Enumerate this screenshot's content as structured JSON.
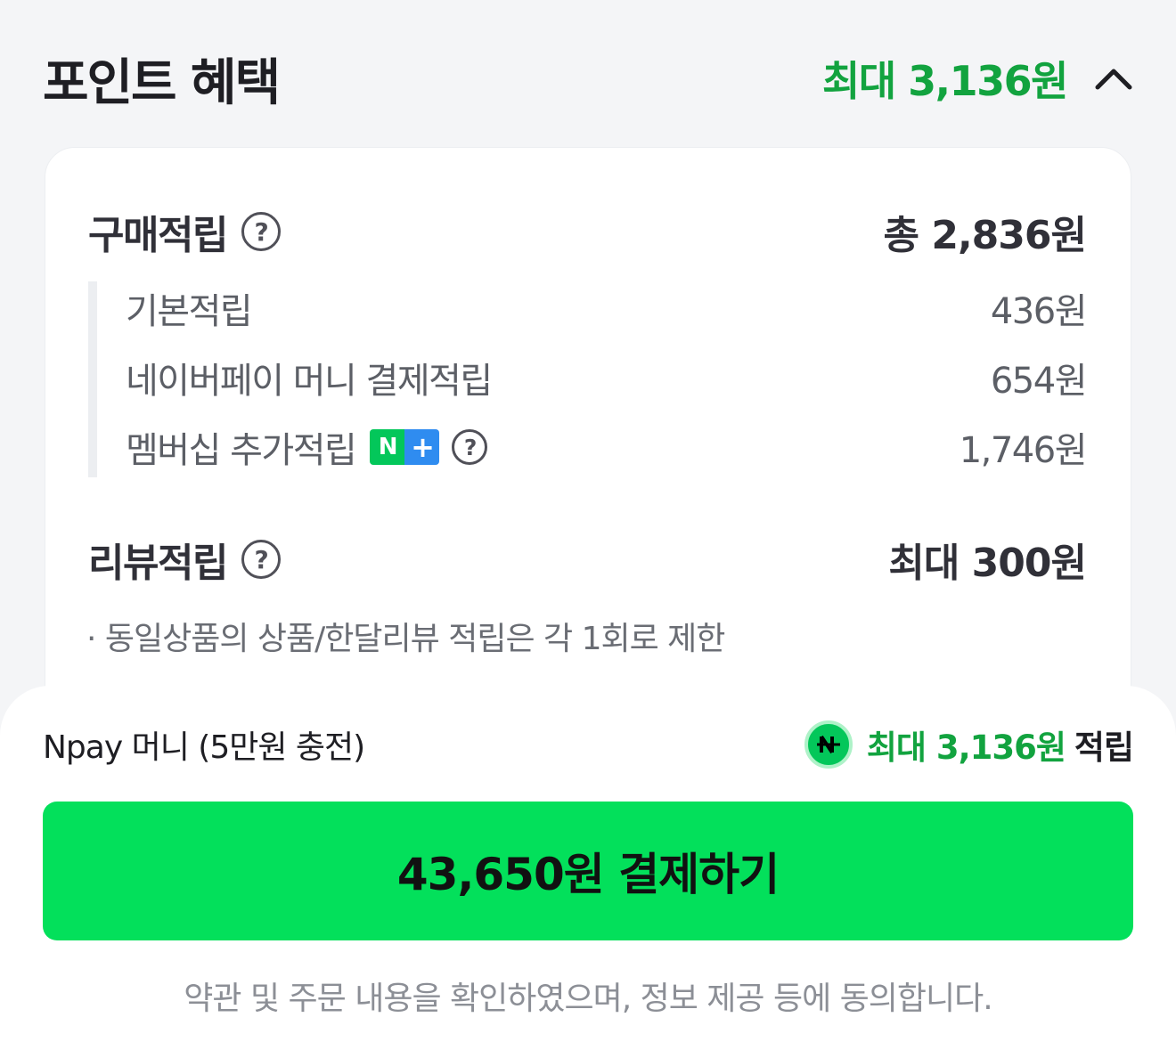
{
  "header": {
    "title": "포인트 혜택",
    "max_benefit": "최대 3,136원"
  },
  "purchase": {
    "label": "구매적립",
    "total": "총 2,836원",
    "items": [
      {
        "label": "기본적립",
        "value": "436원"
      },
      {
        "label": "네이버페이 머니 결제적립",
        "value": "654원"
      },
      {
        "label": "멤버십 추가적립",
        "value": "1,746원",
        "badge": "N+"
      }
    ]
  },
  "review": {
    "label": "리뷰적립",
    "total": "최대 300원",
    "note": "· 동일상품의 상품/한달리뷰 적립은 각 1회로 제한"
  },
  "payment": {
    "method": "Npay 머니 (5만원 충전)",
    "reward_value": "최대 3,136원",
    "reward_suffix": "적립",
    "button_label": "43,650원 결제하기",
    "agreement": "약관 및 주문 내용을 확인하였으며, 정보 제공 등에 동의합니다."
  },
  "colors": {
    "accent_green": "#12a33f",
    "button_green": "#03e05b",
    "naver_green": "#03c75a",
    "plus_blue": "#2f8cf0"
  }
}
